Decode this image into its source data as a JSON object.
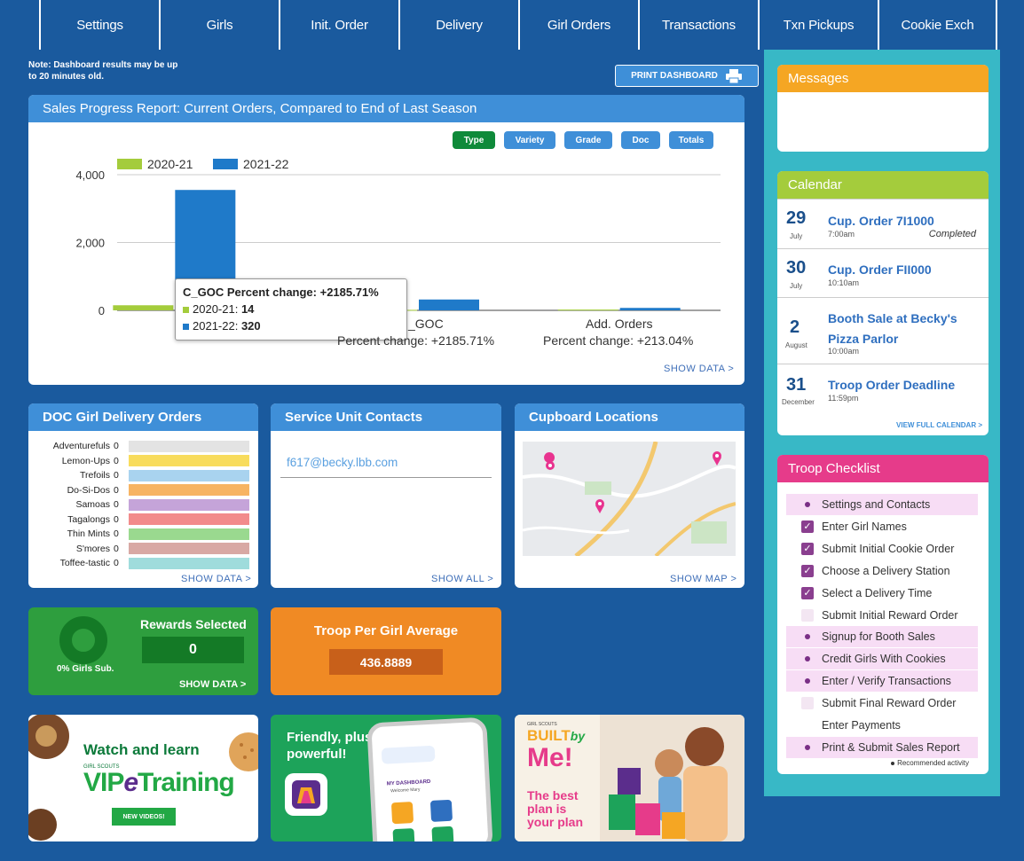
{
  "nav": [
    "Settings",
    "Girls",
    "Init. Order",
    "Delivery",
    "Girl Orders",
    "Transactions",
    "Txn Pickups",
    "Cookie Exch"
  ],
  "note": "Note: Dashboard results may be up to 20 minutes old.",
  "print_button": "PRINT DASHBOARD",
  "sales_card": {
    "title": "Sales Progress Report: Current Orders, Compared to End of Last Season",
    "chips": [
      "Type",
      "Variety",
      "Grade",
      "Doc",
      "Totals"
    ],
    "show_link": "SHOW DATA >",
    "tooltip": {
      "title": "C_GOC Percent change: +2185.71%",
      "rows": [
        {
          "label": "2020-21: ",
          "value": "14"
        },
        {
          "label": "2021-22: ",
          "value": "320"
        }
      ]
    },
    "cat_labels": [
      {
        "name": "_GOC",
        "pct": "Percent change: +2185.71%"
      },
      {
        "name": "Add. Orders",
        "pct": "Percent change: +213.04%"
      }
    ]
  },
  "chart_data": {
    "type": "bar",
    "categories": [
      "",
      "C_GOC",
      "Add. Orders"
    ],
    "series": [
      {
        "name": "2020-21",
        "values": [
          150,
          14,
          23
        ],
        "color": "#a4cc3c"
      },
      {
        "name": "2021-22",
        "values": [
          3550,
          320,
          72
        ],
        "color": "#1f7ac9"
      }
    ],
    "ylim": [
      0,
      4000
    ],
    "yticks": [
      "0",
      "2,000",
      "4,000"
    ],
    "legend": "top-left"
  },
  "doc_card": {
    "title": "DOC Girl Delivery Orders",
    "items": [
      {
        "name": "Adventurefuls",
        "value": "0",
        "color": "#e3e3e3"
      },
      {
        "name": "Lemon-Ups",
        "value": "0",
        "color": "#f8dc5c"
      },
      {
        "name": "Trefoils",
        "value": "0",
        "color": "#a9d3ef"
      },
      {
        "name": "Do-Si-Dos",
        "value": "0",
        "color": "#f7b463"
      },
      {
        "name": "Samoas",
        "value": "0",
        "color": "#c5a4d9"
      },
      {
        "name": "Tagalongs",
        "value": "0",
        "color": "#f28b8b"
      },
      {
        "name": "Thin Mints",
        "value": "0",
        "color": "#9ad98f"
      },
      {
        "name": "S'mores",
        "value": "0",
        "color": "#d8a9a4"
      },
      {
        "name": "Toffee-tastic",
        "value": "0",
        "color": "#9fdcdc"
      }
    ],
    "show_link": "SHOW DATA >"
  },
  "su_card": {
    "title": "Service Unit Contacts",
    "email": "f617@becky.lbb.com",
    "show_link": "SHOW ALL >"
  },
  "cupboard_card": {
    "title": "Cupboard Locations",
    "show_link": "SHOW MAP >"
  },
  "rewards_card": {
    "title": "Rewards Selected",
    "value": "0",
    "donut_label": "0% Girls Sub.",
    "show_link": "SHOW DATA >"
  },
  "avg_card": {
    "title": "Troop Per Girl Average",
    "value": "436.8889"
  },
  "promo1": {
    "line1": "Watch and learn",
    "small": "GIRL SCOUTS",
    "brand": "VIP",
    "brand_e": "e",
    "brand_rest": "Training",
    "badge": "NEW VIDEOS!"
  },
  "promo2": {
    "line1": "Friendly, plus",
    "line2": "powerful!",
    "phone_title": "MY DASHBOARD",
    "phone_sub": "Welcome Mary"
  },
  "promo3": {
    "small": "GIRL SCOUTS",
    "built": "BUILT",
    "by": "by",
    "me": "Me!",
    "tag": "The best plan is your plan"
  },
  "messages": {
    "title": "Messages"
  },
  "calendar": {
    "title": "Calendar",
    "events": [
      {
        "day": "29",
        "month": "July",
        "title": "Cup. Order 7I1000",
        "time": "7:00am",
        "status": "Completed"
      },
      {
        "day": "30",
        "month": "July",
        "title": "Cup. Order FII000",
        "time": "10:10am",
        "status": ""
      },
      {
        "day": "2",
        "month": "August",
        "title": "Booth Sale at Becky's Pizza Parlor",
        "time": "10:00am",
        "status": ""
      },
      {
        "day": "31",
        "month": "December",
        "title": "Troop Order Deadline",
        "time": "11:59pm",
        "status": ""
      }
    ],
    "view_full": "VIEW FULL CALENDAR >"
  },
  "checklist": {
    "title": "Troop Checklist",
    "items": [
      {
        "label": "Settings and Contacts",
        "state": "recommended"
      },
      {
        "label": "Enter Girl Names",
        "state": "checked"
      },
      {
        "label": "Submit Initial Cookie Order",
        "state": "checked"
      },
      {
        "label": "Choose a Delivery Station",
        "state": "checked"
      },
      {
        "label": "Select a Delivery Time",
        "state": "checked"
      },
      {
        "label": "Submit Initial Reward Order",
        "state": "unchecked"
      },
      {
        "label": "Signup for Booth Sales",
        "state": "recommended"
      },
      {
        "label": "Credit Girls With Cookies",
        "state": "recommended"
      },
      {
        "label": "Enter / Verify Transactions",
        "state": "recommended"
      },
      {
        "label": "Submit Final Reward Order",
        "state": "unchecked"
      },
      {
        "label": "Enter Payments",
        "state": "plain"
      },
      {
        "label": "Print & Submit Sales Report",
        "state": "recommended"
      }
    ],
    "footnote": "Recommended activity"
  },
  "colors": {
    "background": "#1a5a9e",
    "header_blue": "#3f8fd8",
    "messages": "#f5a623",
    "calendar": "#a4cc3c",
    "checklist": "#e63b8a",
    "rewards_green": "#2e9e3e",
    "avg_orange": "#f08a24"
  }
}
